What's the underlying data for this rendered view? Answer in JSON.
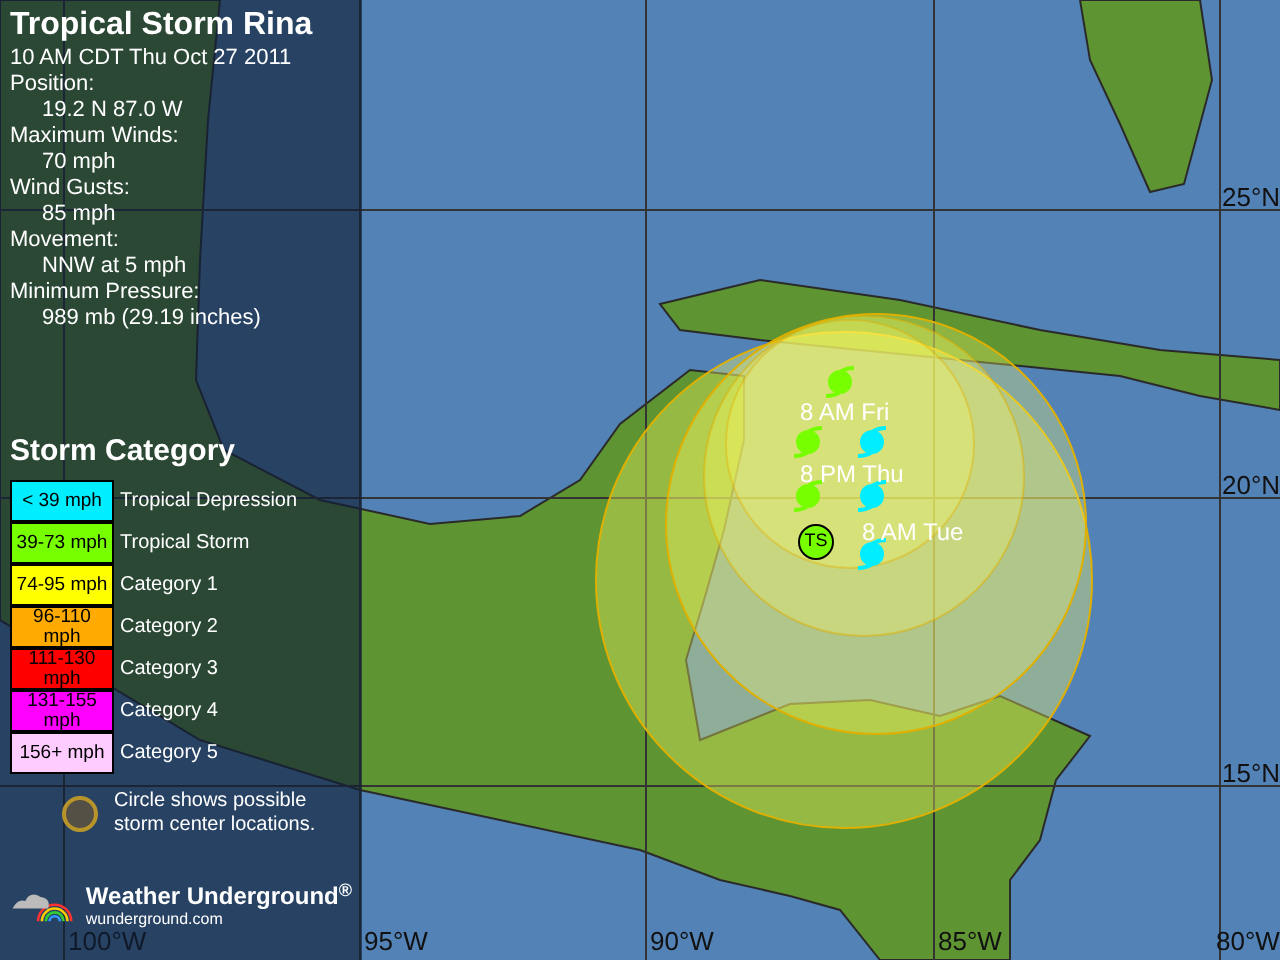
{
  "title": "Tropical Storm Rina",
  "issued": "10 AM CDT Thu Oct 27 2011",
  "fields": [
    {
      "label": "Position:",
      "value": "19.2 N 87.0 W"
    },
    {
      "label": "Maximum Winds:",
      "value": "70 mph"
    },
    {
      "label": "Wind Gusts:",
      "value": "85 mph"
    },
    {
      "label": "Movement:",
      "value": "NNW at 5 mph"
    },
    {
      "label": "Minimum Pressure:",
      "value": "989 mb (29.19 inches)"
    }
  ],
  "legend": {
    "title": "Storm Category",
    "categories": [
      {
        "range": "< 39 mph",
        "name": "Tropical Depression",
        "color": "#00eeff"
      },
      {
        "range": "39-73 mph",
        "name": "Tropical Storm",
        "color": "#77ff00"
      },
      {
        "range": "74-95 mph",
        "name": "Category 1",
        "color": "#ffff00"
      },
      {
        "range": "96-110 mph",
        "name": "Category 2",
        "color": "#ffaa00"
      },
      {
        "range": "111-130 mph",
        "name": "Category 3",
        "color": "#ff0000"
      },
      {
        "range": "131-155 mph",
        "name": "Category 4",
        "color": "#ff00ff"
      },
      {
        "range": "156+ mph",
        "name": "Category 5",
        "color": "#ffccff"
      }
    ],
    "circle_note": "Circle shows possible storm center locations."
  },
  "logo": {
    "name": "Weather Underground",
    "trademark": "®",
    "url": "wunderground.com"
  },
  "longitudes": [
    "100°W",
    "95°W",
    "90°W",
    "85°W",
    "80°W"
  ],
  "latitudes": [
    "25°N",
    "20°N",
    "15°N"
  ],
  "current_storm": {
    "label": "TS",
    "color": "#77ff00"
  },
  "forecast_points": [
    {
      "color": "#77ff00"
    },
    {
      "color": "#77ff00"
    },
    {
      "color": "#77ff00"
    },
    {
      "color": "#00eeff"
    },
    {
      "color": "#00eeff"
    },
    {
      "color": "#00eeff"
    }
  ],
  "time_labels": [
    "8 AM Fri",
    "8 PM Thu",
    "8 AM Tue"
  ]
}
